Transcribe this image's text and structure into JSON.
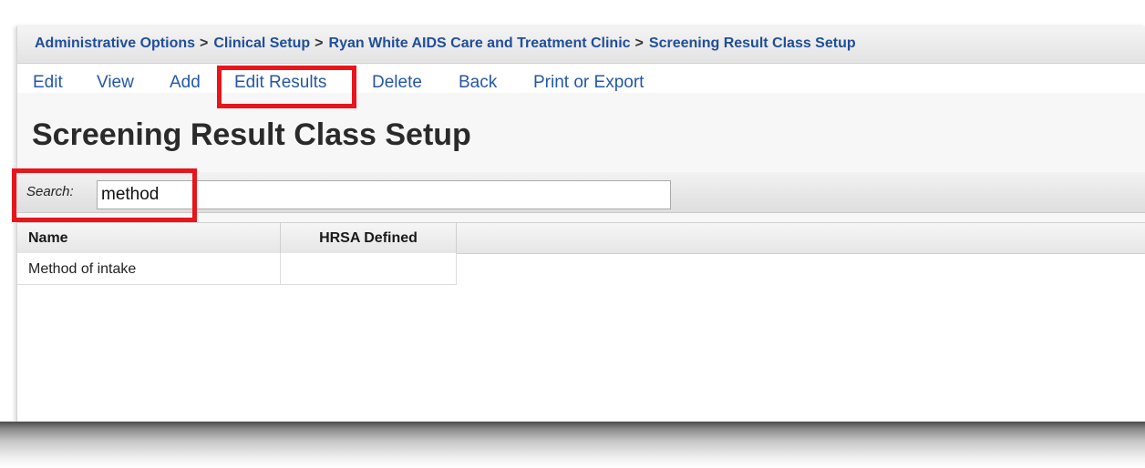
{
  "breadcrumb": {
    "items": [
      "Administrative Options",
      "Clinical Setup",
      "Ryan White AIDS Care and Treatment Clinic",
      "Screening Result Class Setup"
    ],
    "separator": ">"
  },
  "toolbar": {
    "edit": "Edit",
    "view": "View",
    "add": "Add",
    "edit_results": "Edit Results",
    "delete": "Delete",
    "back": "Back",
    "print_export": "Print or Export"
  },
  "page": {
    "title": "Screening Result Class Setup"
  },
  "search": {
    "label": "Search:",
    "value": "method"
  },
  "table": {
    "headers": [
      "Name",
      "HRSA Defined"
    ],
    "rows": [
      [
        "Method of intake",
        ""
      ]
    ]
  },
  "colors": {
    "link": "#2458a6",
    "highlight": "#e8151c"
  }
}
